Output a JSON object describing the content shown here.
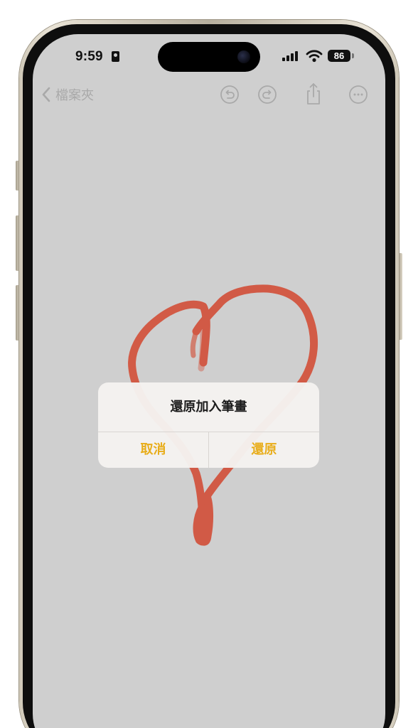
{
  "status_bar": {
    "time": "9:59",
    "battery": "86",
    "icons": [
      "id-card-icon",
      "cellular-signal-icon",
      "wifi-icon",
      "battery-icon"
    ]
  },
  "toolbar": {
    "back_label": "檔案夾",
    "icons": [
      "chevron-left-icon",
      "undo-icon",
      "redo-icon",
      "share-icon",
      "more-icon"
    ]
  },
  "alert": {
    "title": "還原加入筆畫",
    "cancel_label": "取消",
    "confirm_label": "還原"
  },
  "colors": {
    "screen_background": "#cfcfcf",
    "stroke": "#d2513b",
    "alert_accent": "#e8ad1a",
    "toolbar_inactive": "#a9a9a9"
  }
}
